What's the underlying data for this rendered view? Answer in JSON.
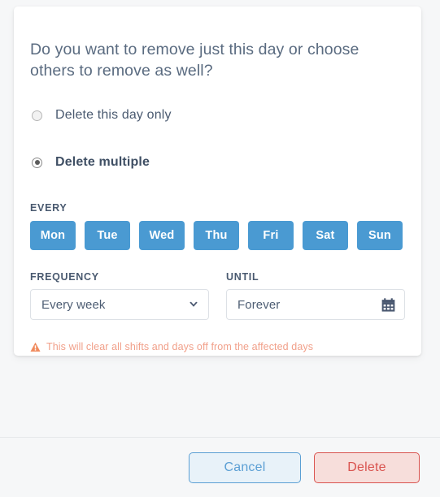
{
  "dialog": {
    "question": "Do you want to remove just this day or choose others to remove as well?",
    "options": [
      {
        "label": "Delete this day only",
        "selected": false
      },
      {
        "label": "Delete multiple",
        "selected": true
      }
    ]
  },
  "every": {
    "label": "EVERY",
    "days": [
      {
        "label": "Mon",
        "active": true
      },
      {
        "label": "Tue",
        "active": true
      },
      {
        "label": "Wed",
        "active": true
      },
      {
        "label": "Thu",
        "active": true
      },
      {
        "label": "Fri",
        "active": true
      },
      {
        "label": "Sat",
        "active": true
      },
      {
        "label": "Sun",
        "active": true
      }
    ]
  },
  "frequency": {
    "label": "FREQUENCY",
    "value": "Every week",
    "icon": "chevron-down-icon"
  },
  "until": {
    "label": "UNTIL",
    "value": "Forever",
    "icon": "calendar-icon"
  },
  "warning": {
    "icon": "warning-triangle-icon",
    "text": "This will clear all shifts and days off from the affected days"
  },
  "footer": {
    "cancel_label": "Cancel",
    "delete_label": "Delete"
  },
  "colors": {
    "day_active": "#4a9ad2",
    "accent_blue": "#5b9fd4",
    "danger_red": "#d9534f",
    "warning_orange": "#f1a08a",
    "text_slate": "#4a5a70",
    "card_bg": "#ffffff",
    "page_bg": "#f6f7f8"
  }
}
